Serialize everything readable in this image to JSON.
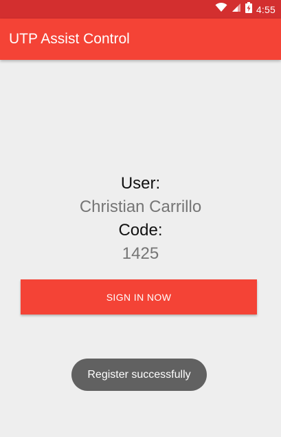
{
  "status_bar": {
    "time": "4:55",
    "icons": [
      "wifi-icon",
      "cellular-signal-icon",
      "battery-charging-icon"
    ],
    "color": "#d32f2f"
  },
  "app_bar": {
    "title": "UTP Assist Control",
    "color": "#f44336"
  },
  "main": {
    "user_label": "User:",
    "user_name": "Christian Carrillo",
    "code_label": "Code:",
    "code_value": "1425",
    "sign_in_label": "SIGN IN NOW"
  },
  "toast": {
    "message": "Register successfully"
  }
}
